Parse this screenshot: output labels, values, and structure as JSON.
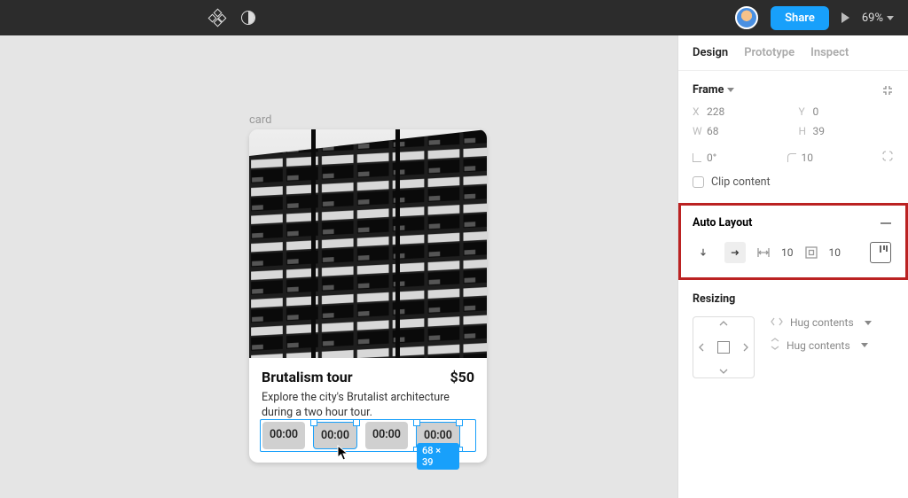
{
  "topbar": {
    "share_label": "Share",
    "zoom": "69%"
  },
  "canvas": {
    "layer_label": "card",
    "card": {
      "title": "Brutalism tour",
      "price": "$50",
      "description": "Explore the city's Brutalist architecture during a two hour tour.",
      "chips": [
        "00:00",
        "00:00",
        "00:00",
        "00:00"
      ]
    },
    "selection_badge": "68 × 39"
  },
  "sidebar": {
    "tabs": {
      "design": "Design",
      "prototype": "Prototype",
      "inspect": "Inspect"
    },
    "frame": {
      "label": "Frame",
      "x_label": "X",
      "x_value": "228",
      "y_label": "Y",
      "y_value": "0",
      "w_label": "W",
      "w_value": "68",
      "h_label": "H",
      "h_value": "39",
      "rotation": "0°",
      "radius": "10",
      "clip_label": "Clip content"
    },
    "auto_layout": {
      "label": "Auto Layout",
      "spacing": "10",
      "padding": "10"
    },
    "resizing": {
      "label": "Resizing",
      "h_mode": "Hug contents",
      "v_mode": "Hug contents"
    }
  }
}
